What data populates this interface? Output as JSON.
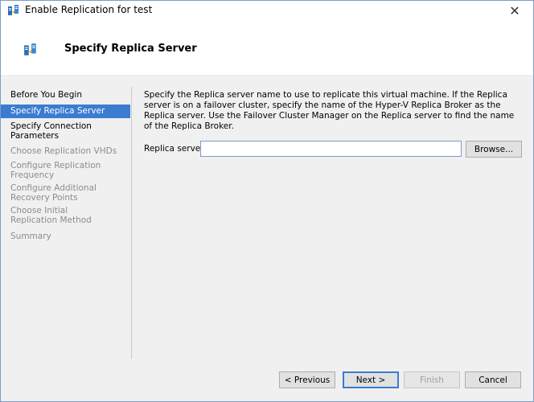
{
  "window": {
    "title": "Enable Replication for test",
    "title_icon": "replication-icon",
    "close_glyph": "✕"
  },
  "header": {
    "title": "Specify Replica Server",
    "icon": "replication-icon"
  },
  "sidebar": {
    "items": [
      {
        "label": "Before You Begin",
        "state": "normal"
      },
      {
        "label": "Specify Replica Server",
        "state": "active"
      },
      {
        "label": "Specify Connection Parameters",
        "state": "normal"
      },
      {
        "label": "Choose Replication VHDs",
        "state": "disabled"
      },
      {
        "label": "Configure Replication Frequency",
        "state": "disabled"
      },
      {
        "label": "Configure Additional Recovery Points",
        "state": "disabled"
      },
      {
        "label": "Choose Initial Replication Method",
        "state": "disabled"
      },
      {
        "label": "Summary",
        "state": "disabled"
      }
    ]
  },
  "main": {
    "description": "Specify the Replica server name to use to replicate this virtual machine. If the Replica server is on a failover cluster, specify the name of the Hyper-V Replica Broker as the Replica server. Use the Failover Cluster Manager on the Replica server to find the name of the Replica Broker.",
    "replica_server_label": "Replica server:",
    "replica_server_value": "",
    "browse_label": "Browse..."
  },
  "footer": {
    "previous_label": "< Previous",
    "next_label": "Next >",
    "finish_label": "Finish",
    "cancel_label": "Cancel"
  },
  "colors": {
    "accent": "#3b7cd1",
    "disabled_text": "#8c8c8c",
    "panel_bg": "#f0f0f0"
  }
}
